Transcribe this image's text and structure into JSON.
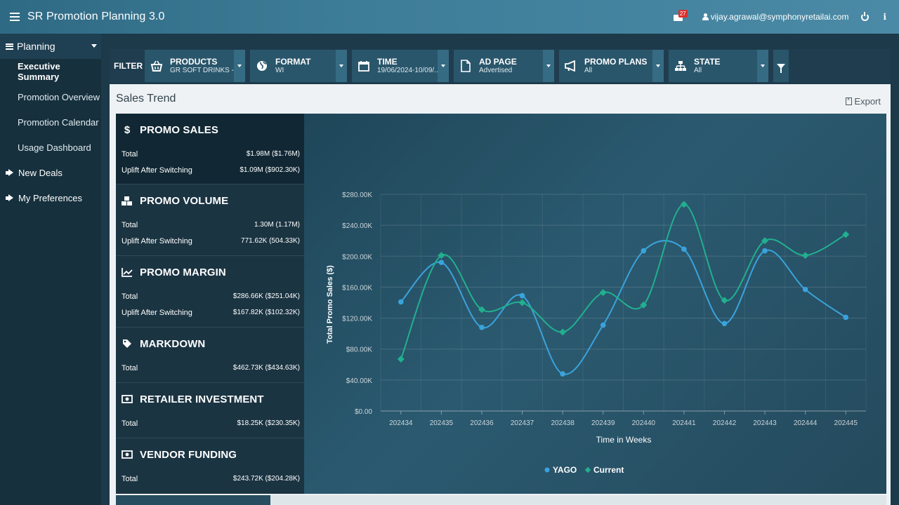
{
  "app": {
    "title": "SR Promotion Planning 3.0"
  },
  "header": {
    "notification_count": "27",
    "user_email": "vijay.agrawal@symphonyretailai.com",
    "info_label": "i"
  },
  "sidebar": {
    "section_label": "Planning",
    "sub_items": [
      {
        "label": "Executive Summary",
        "active": true
      },
      {
        "label": "Promotion Overview"
      },
      {
        "label": "Promotion Calendar"
      },
      {
        "label": "Usage Dashboard"
      }
    ],
    "main_items": [
      {
        "label": "New Deals"
      },
      {
        "label": "My Preferences"
      }
    ]
  },
  "filters": {
    "label": "FILTER",
    "items": [
      {
        "label": "PRODUCTS",
        "value": "GR SOFT DRINKS - 1...",
        "icon": "basket-icon"
      },
      {
        "label": "FORMAT",
        "value": "WI",
        "icon": "globe-icon"
      },
      {
        "label": "TIME",
        "value": "19/06/2024-10/09/...",
        "icon": "calendar-icon"
      },
      {
        "label": "AD PAGE",
        "value": "Advertised",
        "icon": "document-icon"
      },
      {
        "label": "PROMO PLANS",
        "value": "All",
        "icon": "megaphone-icon"
      },
      {
        "label": "STATE",
        "value": "All",
        "icon": "sitemap-icon"
      }
    ]
  },
  "panel": {
    "title": "Sales Trend",
    "export_label": "Export"
  },
  "stats": [
    {
      "title": "PROMO SALES",
      "icon": "dollar-icon",
      "rows": [
        {
          "k": "Total",
          "v": "$1.98M ($1.76M)"
        },
        {
          "k": "Uplift After Switching",
          "v": "$1.09M ($902.30K)"
        }
      ]
    },
    {
      "title": "PROMO VOLUME",
      "icon": "cubes-icon",
      "rows": [
        {
          "k": "Total",
          "v": "1.30M (1.17M)"
        },
        {
          "k": "Uplift After Switching",
          "v": "771.62K (504.33K)"
        }
      ]
    },
    {
      "title": "PROMO MARGIN",
      "icon": "area-chart-icon",
      "rows": [
        {
          "k": "Total",
          "v": "$286.66K ($251.04K)"
        },
        {
          "k": "Uplift After Switching",
          "v": "$167.82K ($102.32K)"
        }
      ]
    },
    {
      "title": "MARKDOWN",
      "icon": "tag-icon",
      "rows": [
        {
          "k": "Total",
          "v": "$462.73K ($434.63K)"
        }
      ]
    },
    {
      "title": "RETAILER INVESTMENT",
      "icon": "money-icon",
      "rows": [
        {
          "k": "Total",
          "v": "$18.25K ($230.35K)"
        }
      ]
    },
    {
      "title": "VENDOR FUNDING",
      "icon": "money-icon",
      "rows": [
        {
          "k": "Total",
          "v": "$243.72K ($204.28K)"
        }
      ]
    }
  ],
  "chart_data": {
    "type": "line",
    "title": "",
    "xlabel": "Time in Weeks",
    "ylabel": "Total Promo Sales ($)",
    "categories": [
      "202434",
      "202435",
      "202436",
      "202437",
      "202438",
      "202439",
      "202440",
      "202441",
      "202442",
      "202443",
      "202444",
      "202445"
    ],
    "ylim": [
      0,
      280000
    ],
    "yticks": [
      "$0.00",
      "$40.00K",
      "$80.00K",
      "$120.00K",
      "$160.00K",
      "$200.00K",
      "$240.00K",
      "$280.00K"
    ],
    "grid": true,
    "legend_position": "bottom",
    "series": [
      {
        "name": "YAGO",
        "color": "#3aa3dc",
        "values": [
          141000,
          192000,
          108000,
          149000,
          48000,
          111000,
          207000,
          209000,
          113000,
          207000,
          157000,
          121000
        ]
      },
      {
        "name": "Current",
        "color": "#21b08f",
        "values": [
          67000,
          201000,
          131000,
          140000,
          102000,
          153000,
          137000,
          267000,
          143000,
          220000,
          201000,
          228000
        ]
      }
    ]
  }
}
